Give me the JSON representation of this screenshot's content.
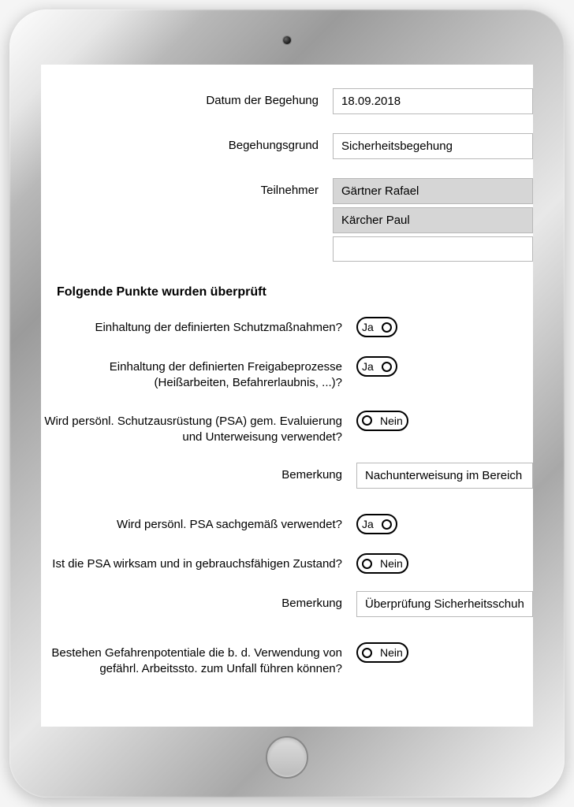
{
  "header": {
    "date_label": "Datum der Begehung",
    "date_value": "18.09.2018",
    "reason_label": "Begehungsgrund",
    "reason_value": "Sicherheitsbegehung",
    "participants_label": "Teilnehmer",
    "participants": [
      "Gärtner Rafael",
      "Kärcher Paul"
    ]
  },
  "section_heading": "Folgende Punkte wurden überprüft",
  "toggle_labels": {
    "yes": "Ja",
    "no": "Nein"
  },
  "checks": [
    {
      "label": "Einhaltung der definierten Schutzmaßnahmen?",
      "value": "ja"
    },
    {
      "label": "Einhaltung der definierten Freigabeprozesse (Heißarbeiten, Befahrerlaubnis, ...)?",
      "value": "ja"
    },
    {
      "label": "Wird persönl. Schutzausrüstung (PSA) gem. Evaluierung und Unterweisung verwendet?",
      "value": "nein"
    }
  ],
  "remark1_label": "Bemerkung",
  "remark1_value": "Nachunterweisung im Bereich Abstu",
  "checks2": [
    {
      "label": "Wird persönl. PSA sachgemäß verwendet?",
      "value": "ja"
    },
    {
      "label": "Ist die PSA wirksam und in gebrauchsfähigen Zustand?",
      "value": "nein"
    }
  ],
  "remark2_label": "Bemerkung",
  "remark2_value": "Überprüfung Sicherheitsschuhe",
  "checks3": [
    {
      "label": "Bestehen Gefahrenpotentiale die b. d. Verwendung von gefährl. Arbeitssto. zum Unfall führen können?",
      "value": "nein"
    }
  ]
}
